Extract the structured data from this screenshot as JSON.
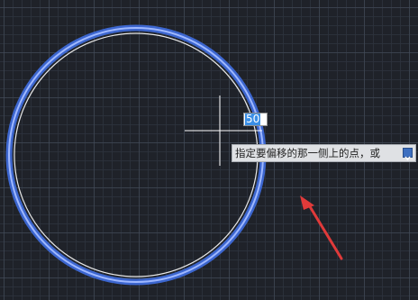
{
  "canvas": {
    "background_color": "#1f2229",
    "grid_major_color": "#464e5c",
    "grid_minor_color": "#2c323c"
  },
  "selected_circle": {
    "highlight_color": "#4a7ee6",
    "outline_color": "#ffffff"
  },
  "offset_circle": {
    "stroke_color": "#e8e8e8"
  },
  "cursor": {
    "icon": "crosshair-cursor-icon",
    "color": "#ffffff"
  },
  "dynamic_input": {
    "value": "50",
    "selection_color": "#3b8fe6"
  },
  "command_prompt": {
    "text": "指定要偏移的那一侧上的点，或",
    "options_icon": "chevron-down-icon"
  },
  "annotation": {
    "icon": "red-arrow-icon",
    "color": "#e03a3a"
  }
}
